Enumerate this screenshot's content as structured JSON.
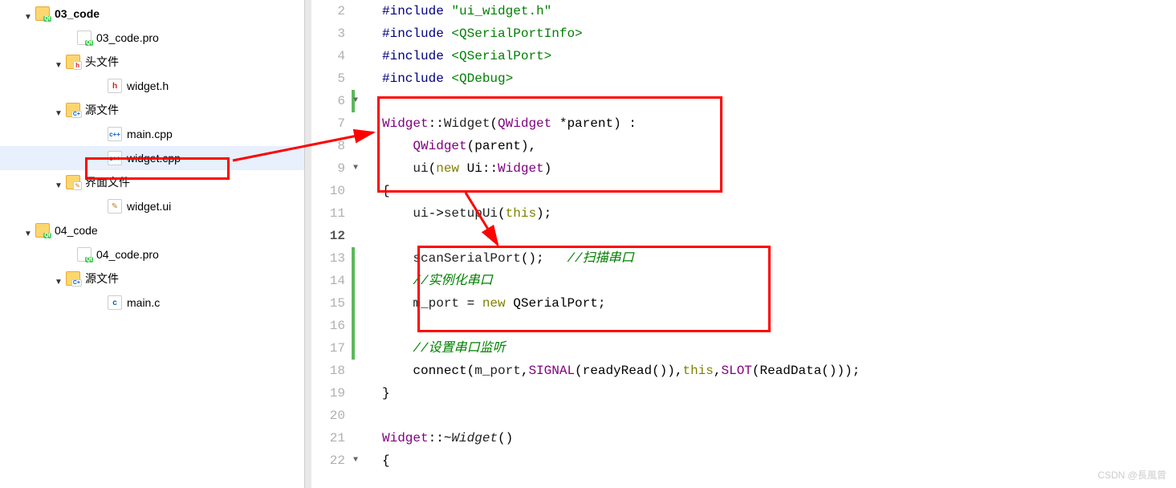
{
  "tree": {
    "p1": {
      "name": "03_code",
      "pro": "03_code.pro",
      "headers": "头文件",
      "h1": "widget.h",
      "sources": "源文件",
      "s1": "main.cpp",
      "s2": "widget.cpp",
      "forms": "界面文件",
      "f1": "widget.ui"
    },
    "p2": {
      "name": "04_code",
      "pro": "04_code.pro",
      "sources": "源文件",
      "s1": "main.c"
    }
  },
  "lines": {
    "2": "2",
    "3": "3",
    "4": "4",
    "5": "5",
    "6": "6",
    "7": "7",
    "8": "8",
    "9": "9",
    "10": "10",
    "11": "11",
    "12": "12",
    "13": "13",
    "14": "14",
    "15": "15",
    "16": "16",
    "17": "17",
    "18": "18",
    "19": "19",
    "20": "20",
    "21": "21",
    "22": "22"
  },
  "code": {
    "inc1a": "#include ",
    "inc1b": "\"ui_widget.h\"",
    "inc2a": "#include ",
    "inc2b": "<QSerialPortInfo>",
    "inc3a": "#include ",
    "inc3b": "<QSerialPort>",
    "inc4a": "#include ",
    "inc4b": "<QDebug>",
    "l7_a": "Widget",
    "l7_b": "::",
    "l7_c": "Widget",
    "l7_d": "(",
    "l7_e": "QWidget",
    "l7_f": " *parent) :",
    "l8_a": "QWidget",
    "l8_b": "(parent),",
    "l9_a": "ui",
    "l9_b": "(",
    "l9_c": "new",
    "l9_d": " Ui::",
    "l9_e": "Widget",
    "l9_f": ")",
    "l10": "{",
    "l11_a": "ui",
    "l11_b": "->",
    "l11_c": "setupUi",
    "l11_d": "(",
    "l11_e": "this",
    "l11_f": ");",
    "l13_a": "scanSerialPort",
    "l13_b": "();   ",
    "l13_c": "//扫描串口",
    "l14": "//实例化串口",
    "l15_a": "m_port",
    "l15_b": " = ",
    "l15_c": "new",
    "l15_d": " QSerialPort;",
    "l17": "//设置串口监听",
    "l18_a": "connect(",
    "l18_b": "m_port",
    "l18_c": ",",
    "l18_d": "SIGNAL",
    "l18_e": "(readyRead()),",
    "l18_f": "this",
    "l18_g": ",",
    "l18_h": "SLOT",
    "l18_i": "(ReadData()));",
    "l19": "}",
    "l21_a": "Widget",
    "l21_b": "::~",
    "l21_c": "Widget",
    "l21_d": "()",
    "l22": "{"
  },
  "watermark": "CSDN @長風曾"
}
